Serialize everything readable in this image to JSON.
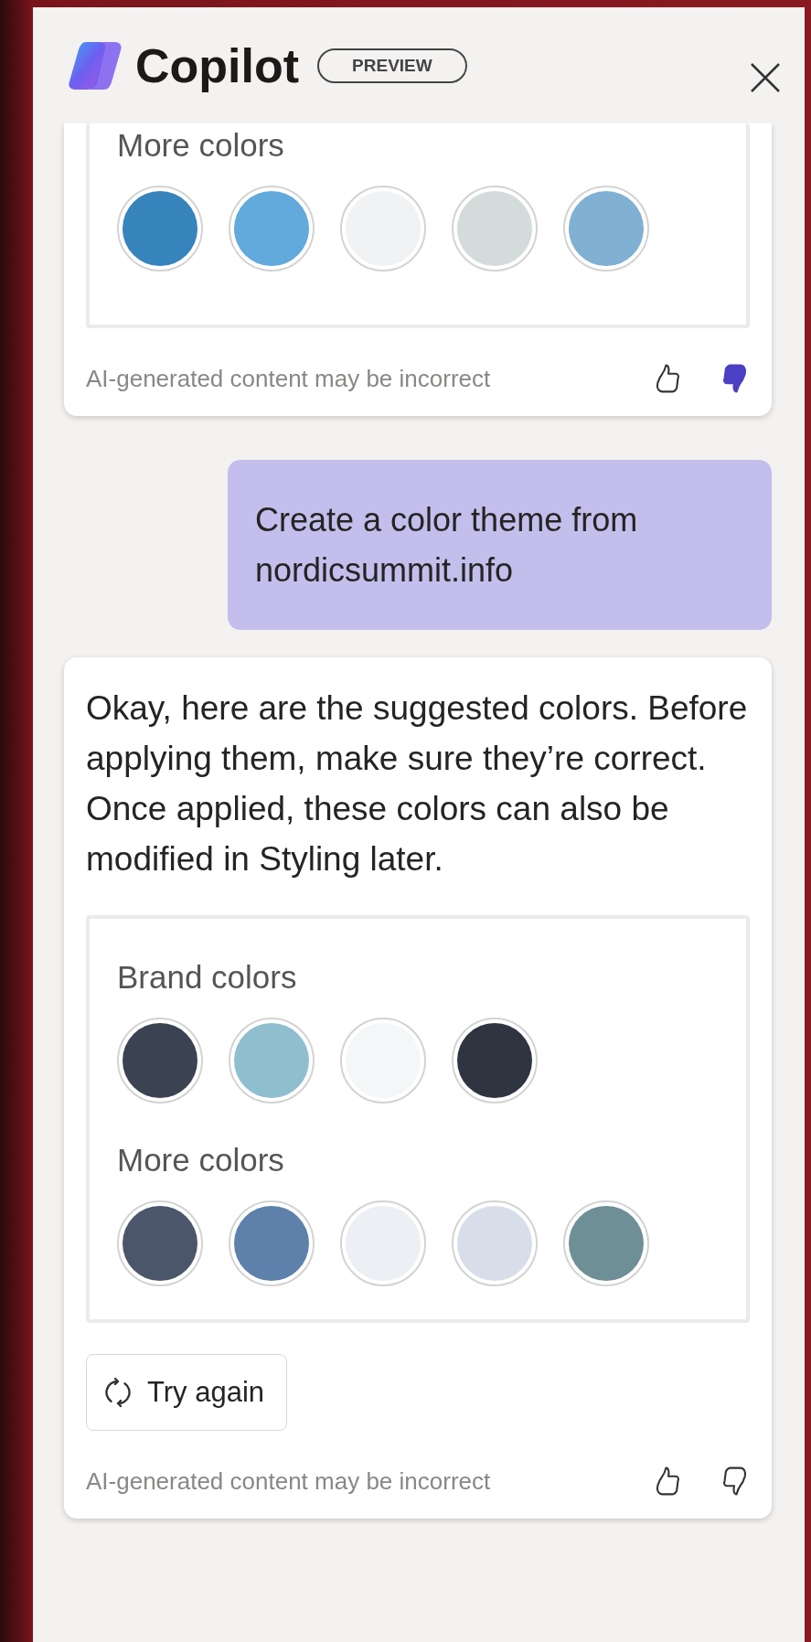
{
  "window": {
    "title": "Copilot",
    "badge": "PREVIEW"
  },
  "messages": [
    {
      "kind": "assistant",
      "continued": true,
      "sections": [
        {
          "title": "More colors",
          "swatches": [
            {
              "color": "#3784bc"
            },
            {
              "color": "#62aadc"
            },
            {
              "color": "#f1f2f4"
            },
            {
              "color": "#d4dbdb"
            },
            {
              "color": "#80b0d2"
            }
          ]
        }
      ],
      "disclaimer": "AI-generated content may be incorrect",
      "feedback": {
        "liked": false,
        "disliked": true
      }
    },
    {
      "kind": "user",
      "text": "Create a color theme from nordicsummit.info"
    },
    {
      "kind": "assistant",
      "continued": false,
      "text": "Okay, here are the suggested colors. Before applying them, make sure they’re correct. Once applied, these colors can also be modified in Styling later.",
      "sections": [
        {
          "title": "Brand colors",
          "swatches": [
            {
              "color": "#3b4252"
            },
            {
              "color": "#8fbfcf"
            },
            {
              "color": "#f4f7f8"
            },
            {
              "color": "#2e3440"
            }
          ]
        },
        {
          "title": "More colors",
          "swatches": [
            {
              "color": "#4c566a"
            },
            {
              "color": "#5e81ac"
            },
            {
              "color": "#eceff4"
            },
            {
              "color": "#d8dee9"
            },
            {
              "color": "#6f8f97"
            }
          ]
        }
      ],
      "retry": "Try again",
      "disclaimer": "AI-generated content may be incorrect",
      "feedback": {
        "liked": false,
        "disliked": false
      }
    }
  ]
}
